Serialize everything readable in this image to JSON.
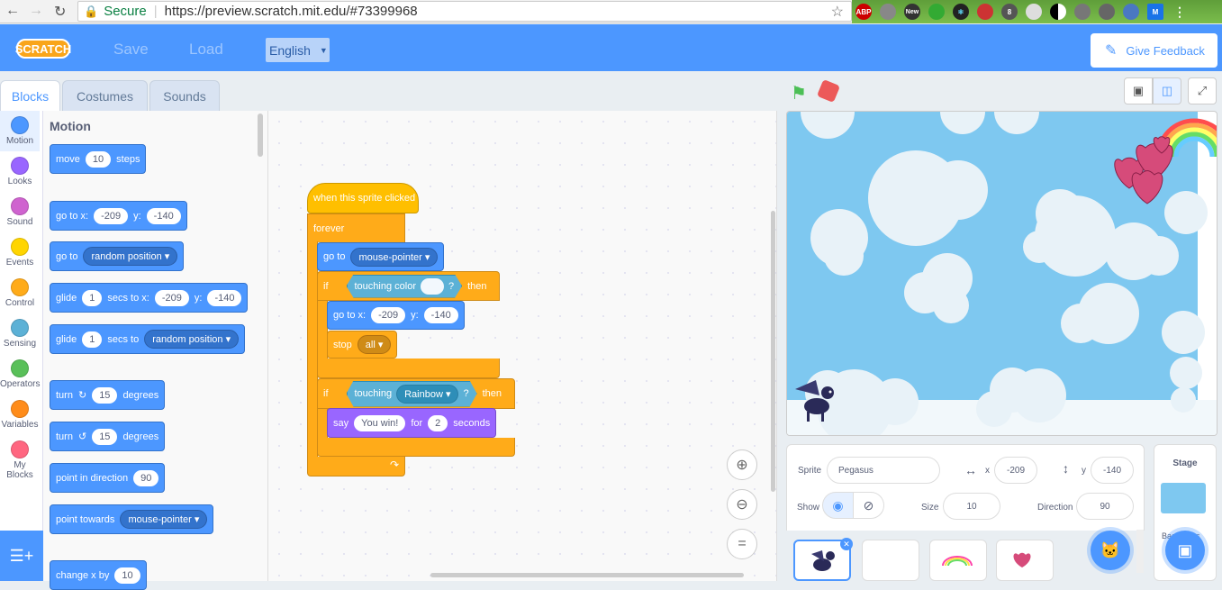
{
  "browser": {
    "secure_label": "Secure",
    "url": "https://preview.scratch.mit.edu/#73399968",
    "extensions": [
      "ABP",
      "New",
      "8",
      "M"
    ]
  },
  "menubar": {
    "logo": "SCRATCH",
    "save": "Save",
    "load": "Load",
    "language": "English",
    "feedback": "Give Feedback"
  },
  "tabs": [
    "Blocks",
    "Costumes",
    "Sounds"
  ],
  "categories": [
    {
      "label": "Motion",
      "color": "#4c97ff"
    },
    {
      "label": "Looks",
      "color": "#9966ff"
    },
    {
      "label": "Sound",
      "color": "#cf63cf"
    },
    {
      "label": "Events",
      "color": "#ffd500"
    },
    {
      "label": "Control",
      "color": "#ffab19"
    },
    {
      "label": "Sensing",
      "color": "#5cb1d6"
    },
    {
      "label": "Operators",
      "color": "#59c059"
    },
    {
      "label": "Variables",
      "color": "#ff8c1a"
    },
    {
      "label": "My Blocks",
      "color": "#ff6680"
    }
  ],
  "palette": {
    "title": "Motion",
    "move": {
      "a": "move",
      "n": "10",
      "b": "steps"
    },
    "goto_xy": {
      "a": "go to x:",
      "x": "-209",
      "b": "y:",
      "y": "-140"
    },
    "goto": {
      "a": "go to",
      "opt": "random position"
    },
    "glide_xy": {
      "a": "glide",
      "n": "1",
      "b": "secs to x:",
      "x": "-209",
      "c": "y:",
      "y": "-140"
    },
    "glide": {
      "a": "glide",
      "n": "1",
      "b": "secs to",
      "opt": "random position"
    },
    "turn_r": {
      "a": "turn",
      "n": "15",
      "b": "degrees"
    },
    "turn_l": {
      "a": "turn",
      "n": "15",
      "b": "degrees"
    },
    "point_dir": {
      "a": "point in direction",
      "n": "90"
    },
    "point_towards": {
      "a": "point towards",
      "opt": "mouse-pointer"
    },
    "change_x": {
      "a": "change x by",
      "n": "10"
    }
  },
  "script": {
    "hat": "when this sprite clicked",
    "forever": "forever",
    "goto": {
      "a": "go to",
      "opt": "mouse-pointer"
    },
    "if1": {
      "if": "if",
      "cond": "touching color",
      "q": "?",
      "then": "then"
    },
    "goto_xy": {
      "a": "go to x:",
      "x": "-209",
      "b": "y:",
      "y": "-140"
    },
    "stop": {
      "a": "stop",
      "opt": "all"
    },
    "if2": {
      "if": "if",
      "cond": "touching",
      "opt": "Rainbow",
      "q": "?",
      "then": "then"
    },
    "say": {
      "a": "say",
      "msg": "You win!",
      "b": "for",
      "n": "2",
      "c": "seconds"
    }
  },
  "sprite_info": {
    "sprite_label": "Sprite",
    "sprite_name": "Pegasus",
    "x_label": "x",
    "x": "-209",
    "y_label": "y",
    "y": "-140",
    "show_label": "Show",
    "size_label": "Size",
    "size": "10",
    "direction_label": "Direction",
    "direction": "90"
  },
  "stage_panel": {
    "label": "Stage",
    "backdrops_label": "Backdrops"
  }
}
